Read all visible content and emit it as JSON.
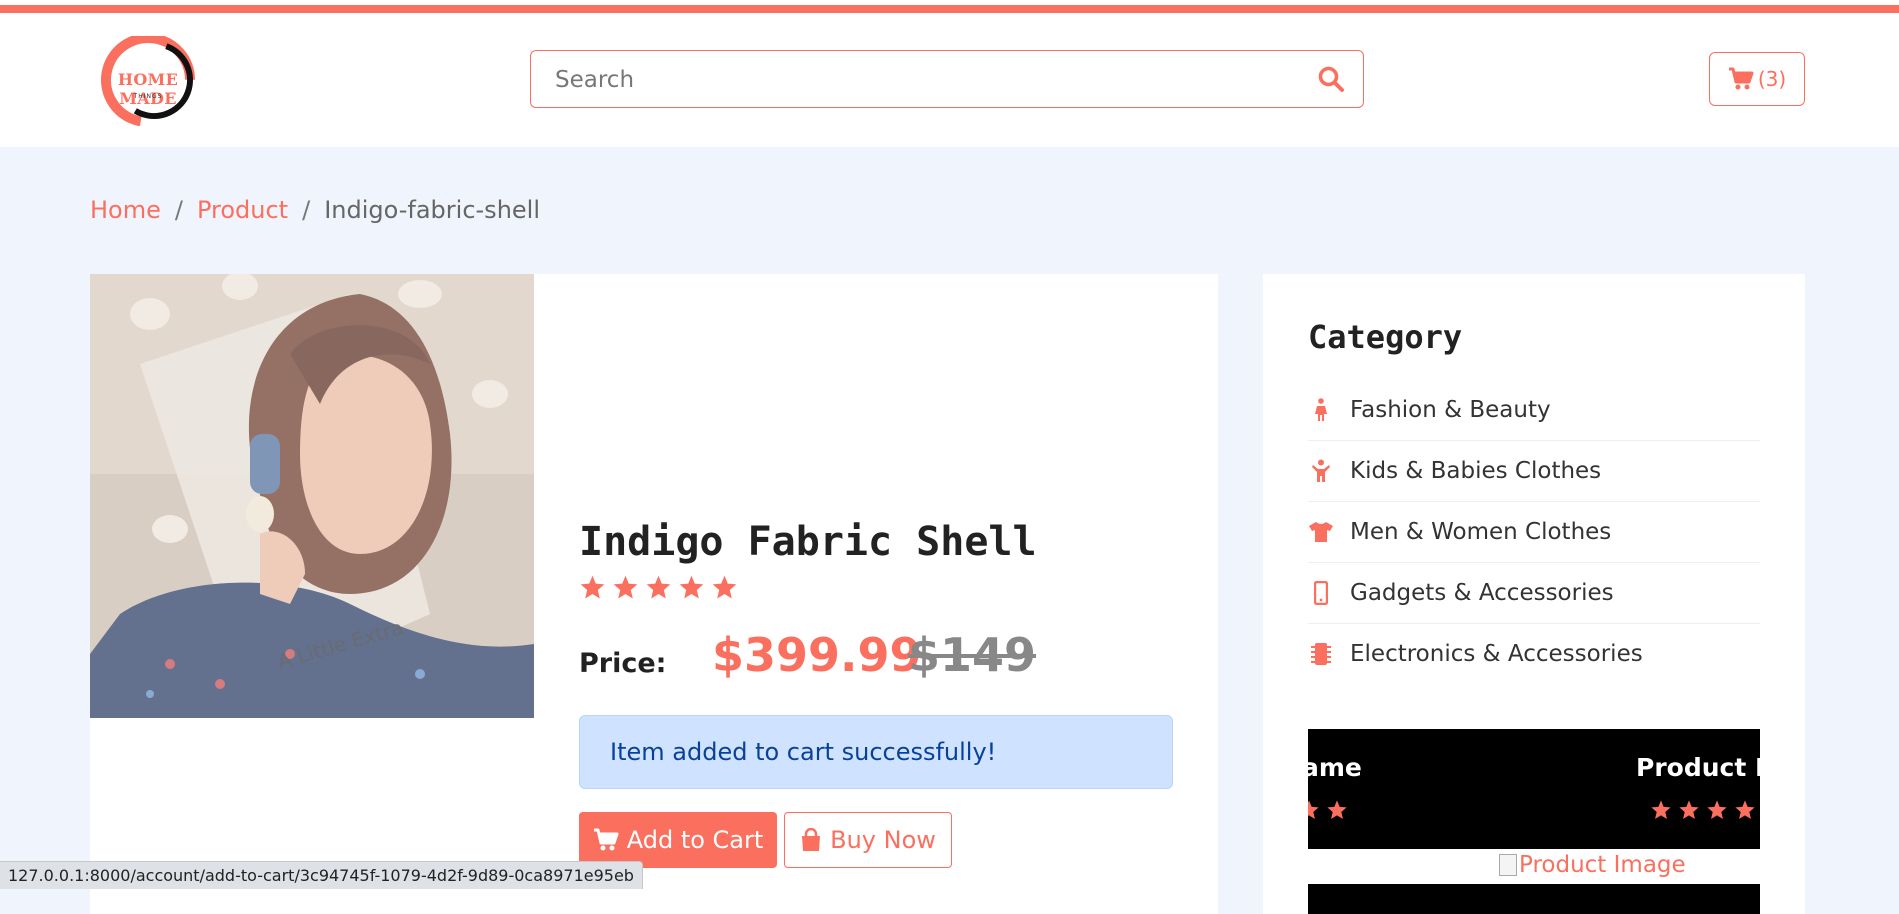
{
  "brand": {
    "logo_text": "HOME MADE",
    "logo_sub": "THINGS"
  },
  "search": {
    "placeholder": "Search"
  },
  "cart": {
    "count_label": "(3)"
  },
  "breadcrumb": {
    "home": "Home",
    "product": "Product",
    "current": "Indigo-fabric-shell",
    "separator": "/"
  },
  "product": {
    "image_caption": "A Little Extra",
    "title": "Indigo Fabric Shell",
    "rating": 5,
    "price_label": "Price:",
    "price": "$399.99",
    "old_price": "$149",
    "alert": "Item added to cart successfully!",
    "add_to_cart_label": "Add to Cart",
    "buy_now_label": "Buy Now"
  },
  "categories": {
    "title": "Category",
    "items": [
      {
        "label": "Fashion & Beauty",
        "icon": "female-icon"
      },
      {
        "label": "Kids & Babies Clothes",
        "icon": "child-icon"
      },
      {
        "label": "Men & Women Clothes",
        "icon": "tshirt-icon"
      },
      {
        "label": "Gadgets & Accessories",
        "icon": "mobile-icon"
      },
      {
        "label": "Electronics & Accessories",
        "icon": "microchip-icon"
      }
    ]
  },
  "slider": {
    "left_name": "ame",
    "right_name": "Product N",
    "image_alt": "Product Image"
  },
  "status_bar": {
    "url": "127.0.0.1:8000/account/add-to-cart/3c94745f-1079-4d2f-9d89-0ca8971e95eb"
  },
  "colors": {
    "accent": "#fb6f5f",
    "page_bg": "#f0f4fd",
    "alert_bg": "#cfe2ff",
    "alert_text": "#084298"
  }
}
